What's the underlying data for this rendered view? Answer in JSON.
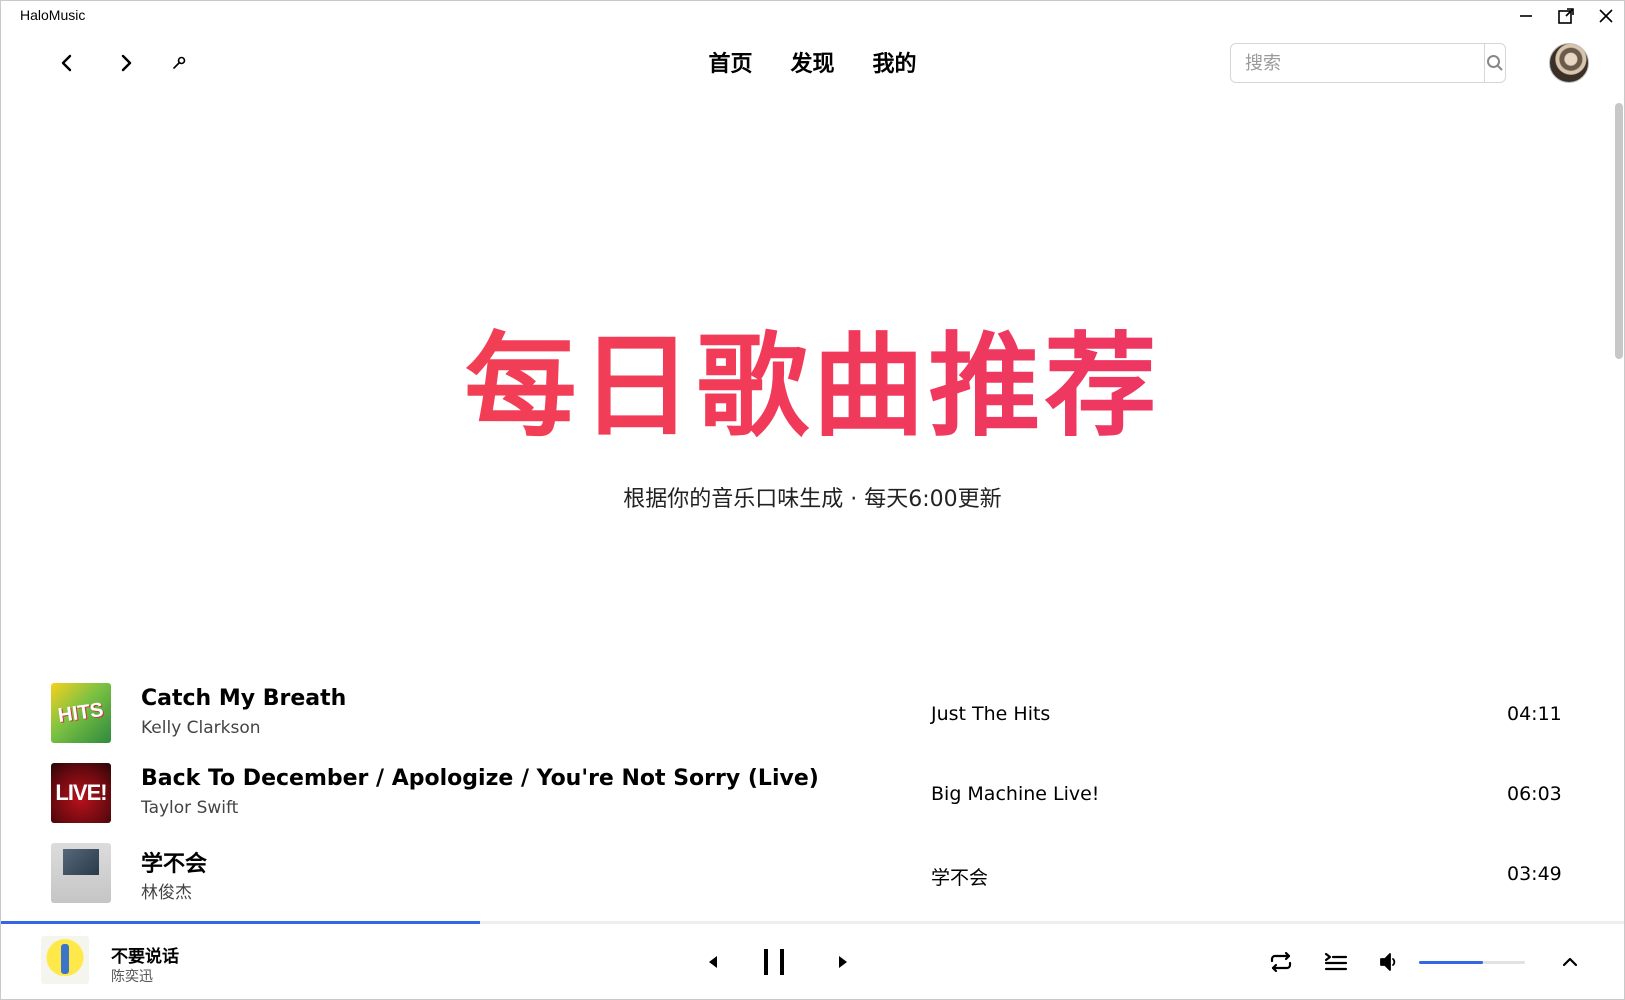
{
  "app": {
    "title": "HaloMusic"
  },
  "header": {
    "tabs": [
      "首页",
      "发现",
      "我的"
    ],
    "search_placeholder": "搜索"
  },
  "hero": {
    "title": "每日歌曲推荐",
    "subtitle": "根据你的音乐口味生成 · 每天6:00更新"
  },
  "songs": [
    {
      "title": "Catch My Breath",
      "artist": "Kelly Clarkson",
      "album": "Just The Hits",
      "duration": "04:11",
      "cover_text": "HITS"
    },
    {
      "title": "Back To December / Apologize / You're Not Sorry (Live)",
      "artist": "Taylor Swift",
      "album": "Big Machine Live!",
      "duration": "06:03",
      "cover_text": "LIVE!"
    },
    {
      "title": "学不会",
      "artist": "林俊杰",
      "album": "学不会",
      "duration": "03:49",
      "cover_text": ""
    }
  ],
  "player": {
    "title": "不要说话",
    "artist": "陈奕迅",
    "progress": 0.295,
    "volume": 0.6
  },
  "colors": {
    "accent": "#3367e6",
    "hero_start": "#f2454e",
    "hero_end": "#e7336f"
  },
  "icons": [
    "back-icon",
    "forward-icon",
    "settings-wrench-icon",
    "search-icon",
    "minimize-icon",
    "popout-icon",
    "close-icon",
    "previous-icon",
    "pause-icon",
    "next-icon",
    "repeat-icon",
    "playlist-icon",
    "volume-icon",
    "expand-up-icon"
  ]
}
